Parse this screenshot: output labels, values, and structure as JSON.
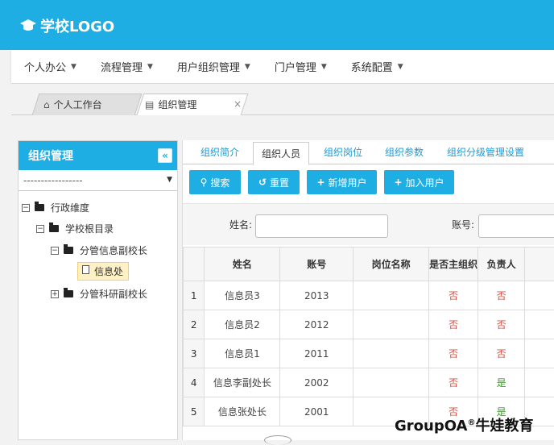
{
  "header": {
    "logo_text": "学校LOGO",
    "bg_color": "#1eaee3"
  },
  "menu": [
    {
      "label": "个人办公"
    },
    {
      "label": "流程管理"
    },
    {
      "label": "用户组织管理"
    },
    {
      "label": "门户管理"
    },
    {
      "label": "系统配置"
    }
  ],
  "page_tabs": [
    {
      "label": "个人工作台",
      "icon": "home-icon"
    },
    {
      "label": "组织管理",
      "icon": "document-icon",
      "close": "×"
    }
  ],
  "left_panel": {
    "title": "组织管理",
    "collapse_glyph": "«",
    "select_value": "-----------------",
    "tree": [
      {
        "label": "行政维度",
        "toggle": "⊟"
      },
      {
        "label": "学校根目录",
        "toggle": "⊟"
      },
      {
        "label": "分管信息副校长",
        "toggle": "⊟"
      },
      {
        "label": "信息处",
        "selected": true
      },
      {
        "label": "分管科研副校长",
        "toggle": "⊞"
      }
    ]
  },
  "content_tabs": [
    {
      "label": "组织简介"
    },
    {
      "label": "组织人员",
      "active": true
    },
    {
      "label": "组织岗位"
    },
    {
      "label": "组织参数"
    },
    {
      "label": "组织分级管理设置"
    }
  ],
  "toolbar": {
    "search": "搜索",
    "reset": "重置",
    "add_new_user": "新增用户",
    "join_user": "加入用户"
  },
  "filter": {
    "name_label": "姓名:",
    "account_label": "账号:"
  },
  "table": {
    "headers": [
      "",
      "姓名",
      "账号",
      "岗位名称",
      "是否主组织",
      "负责人"
    ],
    "rows": [
      {
        "idx": "1",
        "name": "信息员3",
        "account": "2013",
        "post": "",
        "main_org": "否",
        "leader": "否"
      },
      {
        "idx": "2",
        "name": "信息员2",
        "account": "2012",
        "post": "",
        "main_org": "否",
        "leader": "否"
      },
      {
        "idx": "3",
        "name": "信息员1",
        "account": "2011",
        "post": "",
        "main_org": "否",
        "leader": "否"
      },
      {
        "idx": "4",
        "name": "信息李副处长",
        "account": "2002",
        "post": "",
        "main_org": "否",
        "leader": "是"
      },
      {
        "idx": "5",
        "name": "信息张处长",
        "account": "2001",
        "post": "",
        "main_org": "否",
        "leader": "是"
      }
    ]
  },
  "watermark": {
    "text": "GroupOA",
    "reg": "®",
    "suffix": "牛娃教育"
  }
}
